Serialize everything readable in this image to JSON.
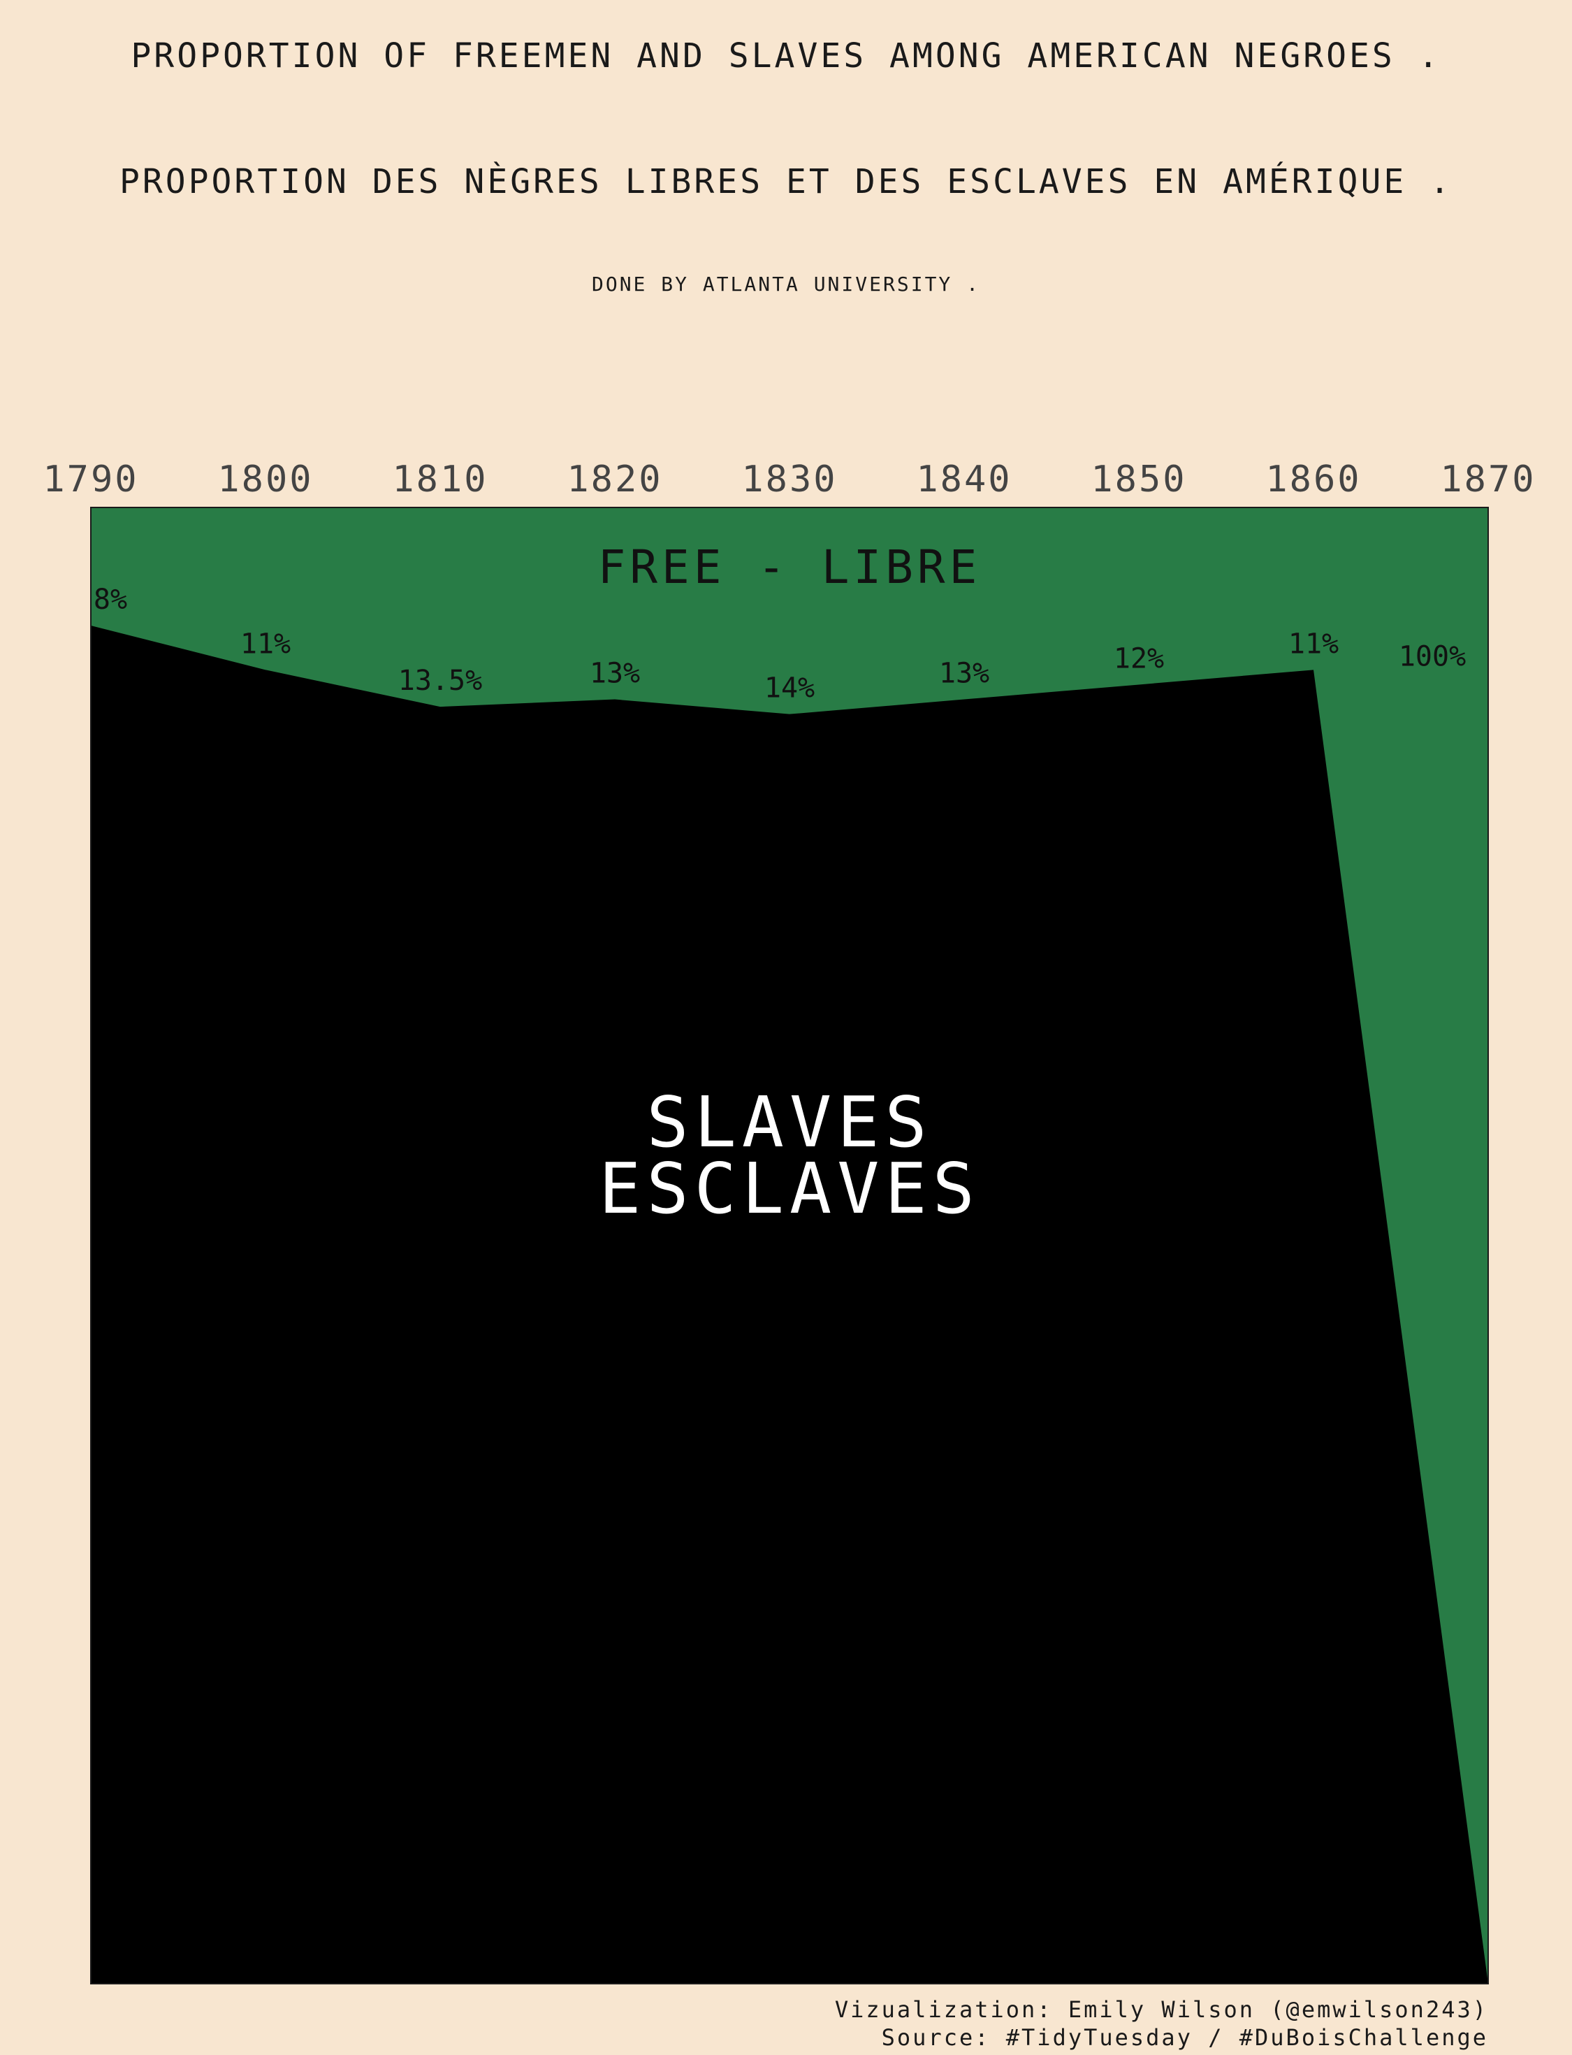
{
  "header": {
    "title_en": "PROPORTION OF FREEMEN AND SLAVES AMONG AMERICAN NEGROES .",
    "title_fr": "PROPORTION DES NÈGRES LIBRES ET DES ESCLAVES EN AMÉRIQUE .",
    "subtitle": "DONE BY ATLANTA UNIVERSITY ."
  },
  "chart_data": {
    "type": "area",
    "x": [
      1790,
      1800,
      1810,
      1820,
      1830,
      1840,
      1850,
      1860,
      1870
    ],
    "x_ticks": [
      "1790",
      "1800",
      "1810",
      "1820",
      "1830",
      "1840",
      "1850",
      "1860",
      "1870"
    ],
    "free_percent": [
      8,
      11,
      13.5,
      13,
      14,
      13,
      12,
      11,
      100
    ],
    "data_labels": [
      "8%",
      "11%",
      "13.5%",
      "13%",
      "14%",
      "13%",
      "12%",
      "11%",
      "100%"
    ],
    "xlim": [
      1790,
      1870
    ],
    "ylim": [
      0,
      100
    ],
    "grid": false,
    "area_labels": {
      "free": "FREE - LIBRE",
      "slaves_line1": "SLAVES",
      "slaves_line2": "ESCLAVES"
    },
    "colors": {
      "free": "#287c46",
      "slaves": "#000000",
      "background": "#f8e6d0"
    }
  },
  "footer": {
    "credit": "Vizualization: Emily Wilson (@emwilson243)",
    "source": "Source: #TidyTuesday / #DuBoisChallenge"
  }
}
